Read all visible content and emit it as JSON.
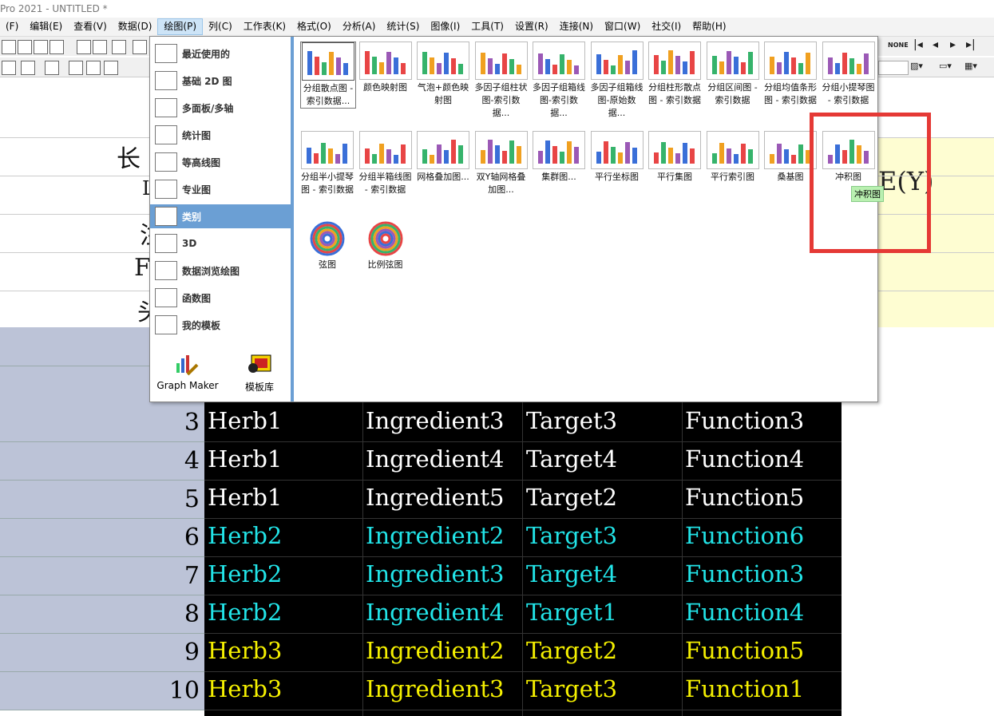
{
  "title": "Pro 2021 - UNTITLED *",
  "menu": [
    "(F)",
    "编辑(E)",
    "查看(V)",
    "数据(D)",
    "绘图(P)",
    "列(C)",
    "工作表(K)",
    "格式(O)",
    "分析(A)",
    "统计(S)",
    "图像(I)",
    "工具(T)",
    "设置(R)",
    "连接(N)",
    "窗口(W)",
    "社交(I)",
    "帮助(H)"
  ],
  "toolbar_right_label": "NONE",
  "sidebar": {
    "items": [
      {
        "label": "最近使用的",
        "icon": "recent-icon"
      },
      {
        "label": "基础 2D 图",
        "icon": "line-chart-icon"
      },
      {
        "label": "多面板/多轴",
        "icon": "multi-panel-icon"
      },
      {
        "label": "统计图",
        "icon": "histogram-icon"
      },
      {
        "label": "等高线图",
        "icon": "contour-icon"
      },
      {
        "label": "专业图",
        "icon": "radar-icon"
      },
      {
        "label": "类别",
        "icon": "categorical-icon"
      },
      {
        "label": "3D",
        "icon": "3d-icon"
      },
      {
        "label": "数据浏览绘图",
        "icon": "data-explore-icon"
      },
      {
        "label": "函数图",
        "icon": "function-icon"
      },
      {
        "label": "我的模板",
        "icon": "template-icon"
      }
    ],
    "selected": 6,
    "graph_maker": "Graph Maker",
    "template_lib": "模板库"
  },
  "gallery": [
    {
      "label": "分组散点图 - 索引数据...",
      "icon": "grouped-scatter-icon"
    },
    {
      "label": "颜色映射图",
      "icon": "color-map-icon"
    },
    {
      "label": "气泡+颜色映射图",
      "icon": "bubble-icon"
    },
    {
      "label": "多因子组柱状图-索引数据...",
      "icon": "multi-factor-bar-icon"
    },
    {
      "label": "多因子组箱线图-索引数据...",
      "icon": "box-index-icon"
    },
    {
      "label": "多因子组箱线图-原始数据...",
      "icon": "box-raw-icon"
    },
    {
      "label": "分组柱形散点图 - 索引数据",
      "icon": "column-scatter-icon"
    },
    {
      "label": "分组区间图 - 索引数据",
      "icon": "interval-icon"
    },
    {
      "label": "分组均值条形图 - 索引数据",
      "icon": "mean-bar-icon"
    },
    {
      "label": "分组小提琴图 - 索引数据",
      "icon": "violin-icon"
    },
    {
      "label": "分组半小提琴图 - 索引数据",
      "icon": "half-violin-icon"
    },
    {
      "label": "分组半箱线图 - 索引数据",
      "icon": "half-box-icon"
    },
    {
      "label": "网格叠加图...",
      "icon": "grid-overlay-icon"
    },
    {
      "label": "双Y轴网格叠加图...",
      "icon": "dual-y-grid-icon"
    },
    {
      "label": "集群图...",
      "icon": "cluster-icon"
    },
    {
      "label": "平行坐标图",
      "icon": "parallel-coord-icon"
    },
    {
      "label": "平行集图",
      "icon": "parallel-sets-icon"
    },
    {
      "label": "平行索引图",
      "icon": "parallel-index-icon"
    },
    {
      "label": "桑基图",
      "icon": "sankey-icon"
    },
    {
      "label": "冲积图",
      "icon": "alluvial-icon"
    },
    {
      "label": "弦图",
      "icon": "chord-icon"
    },
    {
      "label": "比例弦图",
      "icon": "proportional-chord-icon"
    }
  ],
  "tooltip": "冲积图",
  "column_header_e": "E(Y)",
  "row_labels_fragment": [
    "长",
    "L",
    "注",
    "F",
    "头"
  ],
  "table": {
    "rows": [
      {
        "n": "3",
        "herb": "Herb1",
        "ingredient": "Ingredient3",
        "target": "Target3",
        "function": "Function3",
        "color": "#ffffff"
      },
      {
        "n": "4",
        "herb": "Herb1",
        "ingredient": "Ingredient4",
        "target": "Target4",
        "function": "Function4",
        "color": "#ffffff"
      },
      {
        "n": "5",
        "herb": "Herb1",
        "ingredient": "Ingredient5",
        "target": "Target2",
        "function": "Function5",
        "color": "#ffffff"
      },
      {
        "n": "6",
        "herb": "Herb2",
        "ingredient": "Ingredient2",
        "target": "Target3",
        "function": "Function6",
        "color": "#22e4e8"
      },
      {
        "n": "7",
        "herb": "Herb2",
        "ingredient": "Ingredient3",
        "target": "Target4",
        "function": "Function3",
        "color": "#22e4e8"
      },
      {
        "n": "8",
        "herb": "Herb2",
        "ingredient": "Ingredient4",
        "target": "Target1",
        "function": "Function4",
        "color": "#22e4e8"
      },
      {
        "n": "9",
        "herb": "Herb3",
        "ingredient": "Ingredient2",
        "target": "Target2",
        "function": "Function5",
        "color": "#f5f000"
      },
      {
        "n": "10",
        "herb": "Herb3",
        "ingredient": "Ingredient3",
        "target": "Target3",
        "function": "Function1",
        "color": "#f5f000"
      }
    ]
  },
  "colors": {
    "sidebar_selected": "#6b9fd4",
    "highlight": "#e53935",
    "rowheader": "#bcc3d7"
  }
}
